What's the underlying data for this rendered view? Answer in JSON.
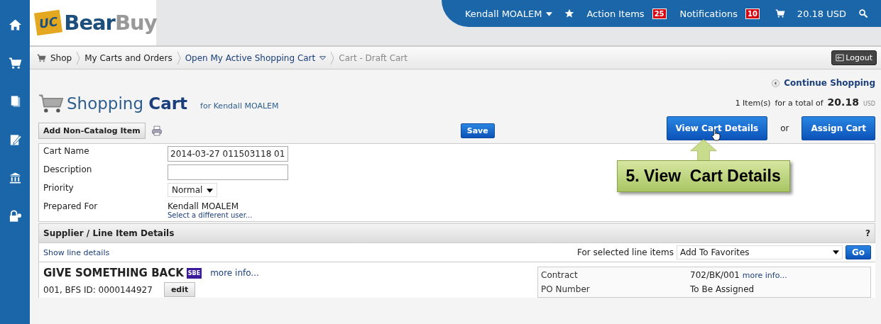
{
  "logo": {
    "badge": "UC",
    "first": "Bear",
    "second": "Buy"
  },
  "user_menu": {
    "user": "Kendall MOALEM",
    "action_items": {
      "label": "Action Items",
      "count": "25"
    },
    "notifications": {
      "label": "Notifications",
      "count": "10"
    },
    "cart_total": "20.18 USD"
  },
  "breadcrumbs": [
    {
      "label": "Shop",
      "kind": "shop"
    },
    {
      "label": "My Carts and Orders",
      "kind": "link"
    },
    {
      "label": "Open My Active Shopping Cart",
      "kind": "menu"
    },
    {
      "label": "Cart - Draft Cart",
      "kind": "current"
    }
  ],
  "logout": "Logout",
  "continue_shopping": "Continue Shopping",
  "summary": {
    "items": "1 Item(s)",
    "for_total": "for a total of",
    "total": "20.18",
    "currency": "USD"
  },
  "title": {
    "light": "Shopping",
    "bold": "Cart",
    "for": "for Kendall MOALEM"
  },
  "add_item": "Add Non-Catalog Item",
  "save": "Save",
  "view_details": "View Cart Details",
  "or": "or",
  "assign": "Assign Cart",
  "callout": "5. View  Cart Details",
  "fields": [
    {
      "label": "Cart Name",
      "kind": "input",
      "value": "2014-03-27 011503118 01"
    },
    {
      "label": "Description",
      "kind": "input"
    },
    {
      "label": "Priority",
      "kind": "select",
      "value": "Normal"
    },
    {
      "label": "Prepared For",
      "kind": "text",
      "value": "Kendall MOALEM",
      "link": "Select a different user..."
    }
  ],
  "section": {
    "title": "Supplier / Line Item Details",
    "help": "?",
    "show_details": "Show line details",
    "bulk_label": "For selected line items",
    "bulk_action": "Add To Favorites",
    "go": "Go"
  },
  "supplier": {
    "name": "GIVE SOMETHING BACK",
    "tag": "SBE",
    "more": "more info...",
    "id": "001, BFS ID: 0000144927",
    "edit": "edit"
  },
  "details": [
    {
      "label": "Contract",
      "value": "702/BK/001",
      "link": "more info..."
    },
    {
      "label": "PO Number",
      "value": "To Be Assigned"
    }
  ]
}
